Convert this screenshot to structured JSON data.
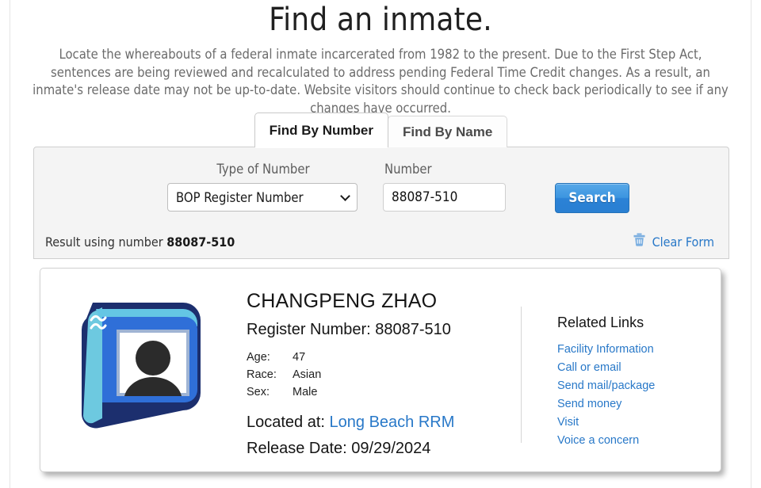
{
  "header": {
    "title": "Find an inmate.",
    "intro": "Locate the whereabouts of a federal inmate incarcerated from 1982 to the present. Due to the First Step Act, sentences are being reviewed and recalculated to address pending Federal Time Credit changes. As a result, an inmate's release date may not be up-to-date. Website visitors should continue to check back periodically to see if any changes have occurred."
  },
  "tabs": [
    {
      "label": "Find By Number",
      "active": true
    },
    {
      "label": "Find By Name",
      "active": false
    }
  ],
  "search_form": {
    "type_label": "Type of Number",
    "type_value": "BOP Register Number",
    "type_chevron_icon": "chevron-down-icon",
    "number_label": "Number",
    "number_value": "88087-510",
    "number_placeholder": "",
    "search_button": "Search",
    "result_prefix": "Result using number ",
    "result_number": "88087-510",
    "clear_form_label": "Clear Form",
    "clear_form_icon": "trash-icon"
  },
  "result": {
    "avatar_icon": "photo-placeholder-icon",
    "name": "CHANGPENG ZHAO",
    "register_number_line": "Register Number: 88087-510",
    "attributes": [
      {
        "key": "Age:",
        "value": "47"
      },
      {
        "key": "Race:",
        "value": "Asian"
      },
      {
        "key": "Sex:",
        "value": "Male"
      }
    ],
    "located_at_label": "Located at:",
    "located_at_value": "Long Beach RRM",
    "release_date_line": "Release Date: 09/29/2024"
  },
  "related_links": {
    "title": "Related Links",
    "items": [
      "Facility Information",
      "Call or email",
      "Send mail/package",
      "Send money",
      "Visit",
      "Voice a concern"
    ]
  },
  "colors": {
    "link_blue": "#2878c8",
    "button_blue": "#3c95e0",
    "panel_gray": "#f4f4f4",
    "text_gray": "#6b6b6b"
  }
}
